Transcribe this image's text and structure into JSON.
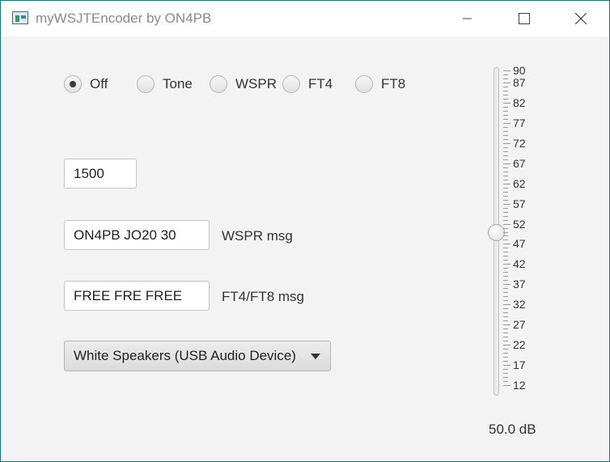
{
  "window": {
    "title": "myWSJTEncoder by ON4PB"
  },
  "modes": [
    {
      "label": "Off",
      "checked": true
    },
    {
      "label": "Tone",
      "checked": false
    },
    {
      "label": "WSPR",
      "checked": false
    },
    {
      "label": "FT4",
      "checked": false
    },
    {
      "label": "FT8",
      "checked": false
    }
  ],
  "frequency": {
    "value": "1500"
  },
  "wspr": {
    "value": "ON4PB JO20 30",
    "label": "WSPR msg"
  },
  "ft": {
    "value": "FREE FRE FREE",
    "label": "FT4/FT8 msg"
  },
  "audio_device": {
    "selected": "White Speakers (USB Audio Device)"
  },
  "level_slider": {
    "min": 10,
    "max": 90,
    "value": 50.0,
    "tick_labels": [
      "90",
      "87",
      "82",
      "77",
      "72",
      "67",
      "62",
      "57",
      "52",
      "47",
      "42",
      "37",
      "32",
      "27",
      "22",
      "17",
      "12"
    ],
    "readout": "50.0 dB"
  },
  "icons": {
    "minimize": "minimize-icon",
    "maximize": "maximize-icon",
    "close": "close-icon",
    "app": "app-icon"
  }
}
